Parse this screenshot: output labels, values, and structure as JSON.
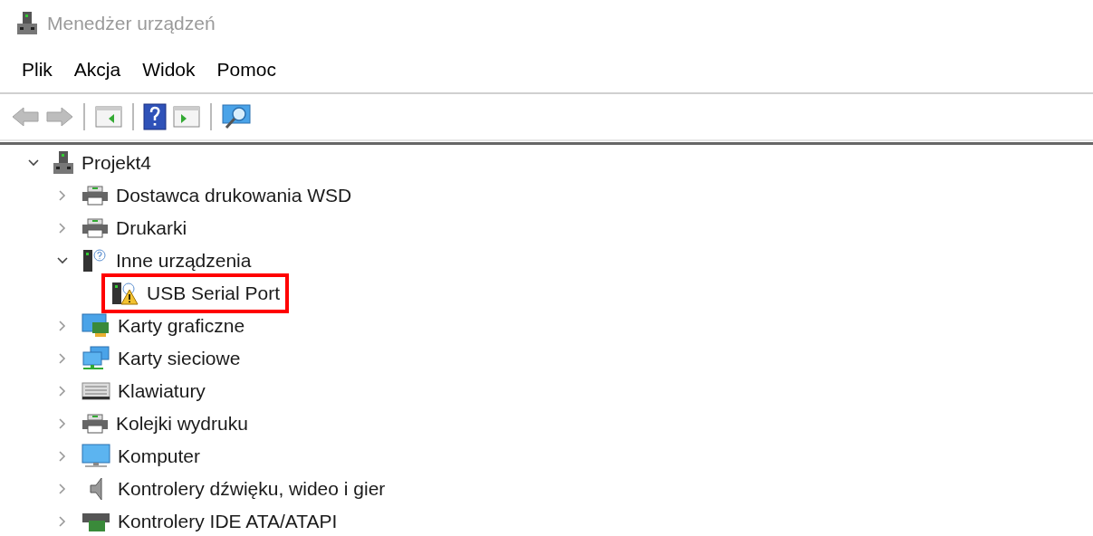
{
  "window": {
    "title": "Menedżer urządzeń"
  },
  "menu": [
    "Plik",
    "Akcja",
    "Widok",
    "Pomoc"
  ],
  "toolbar": [
    {
      "kind": "back",
      "disabled": true
    },
    {
      "kind": "forward",
      "disabled": true
    },
    {
      "kind": "separator"
    },
    {
      "kind": "panel-left"
    },
    {
      "kind": "separator"
    },
    {
      "kind": "help"
    },
    {
      "kind": "panel-right"
    },
    {
      "kind": "separator"
    },
    {
      "kind": "scan"
    }
  ],
  "tree": [
    {
      "label": "Projekt4",
      "kind": "computer-root",
      "expanded": true,
      "children": [
        {
          "label": "Dostawca drukowania WSD",
          "kind": "printer",
          "expanded": false
        },
        {
          "label": "Drukarki",
          "kind": "printer",
          "expanded": false
        },
        {
          "label": "Inne urządzenia",
          "kind": "unknown-device",
          "expanded": true,
          "children": [
            {
              "label": "USB Serial Port",
              "kind": "warning-device",
              "highlighted": true
            }
          ]
        },
        {
          "label": "Karty graficzne",
          "kind": "display-card",
          "expanded": false
        },
        {
          "label": "Karty sieciowe",
          "kind": "network",
          "expanded": false
        },
        {
          "label": "Klawiatury",
          "kind": "keyboard",
          "expanded": false
        },
        {
          "label": "Kolejki wydruku",
          "kind": "printer",
          "expanded": false
        },
        {
          "label": "Komputer",
          "kind": "monitor",
          "expanded": false
        },
        {
          "label": "Kontrolery dźwięku, wideo i gier",
          "kind": "speaker",
          "expanded": false
        },
        {
          "label": "Kontrolery IDE ATA/ATAPI",
          "kind": "ide-card",
          "expanded": false
        }
      ]
    }
  ]
}
